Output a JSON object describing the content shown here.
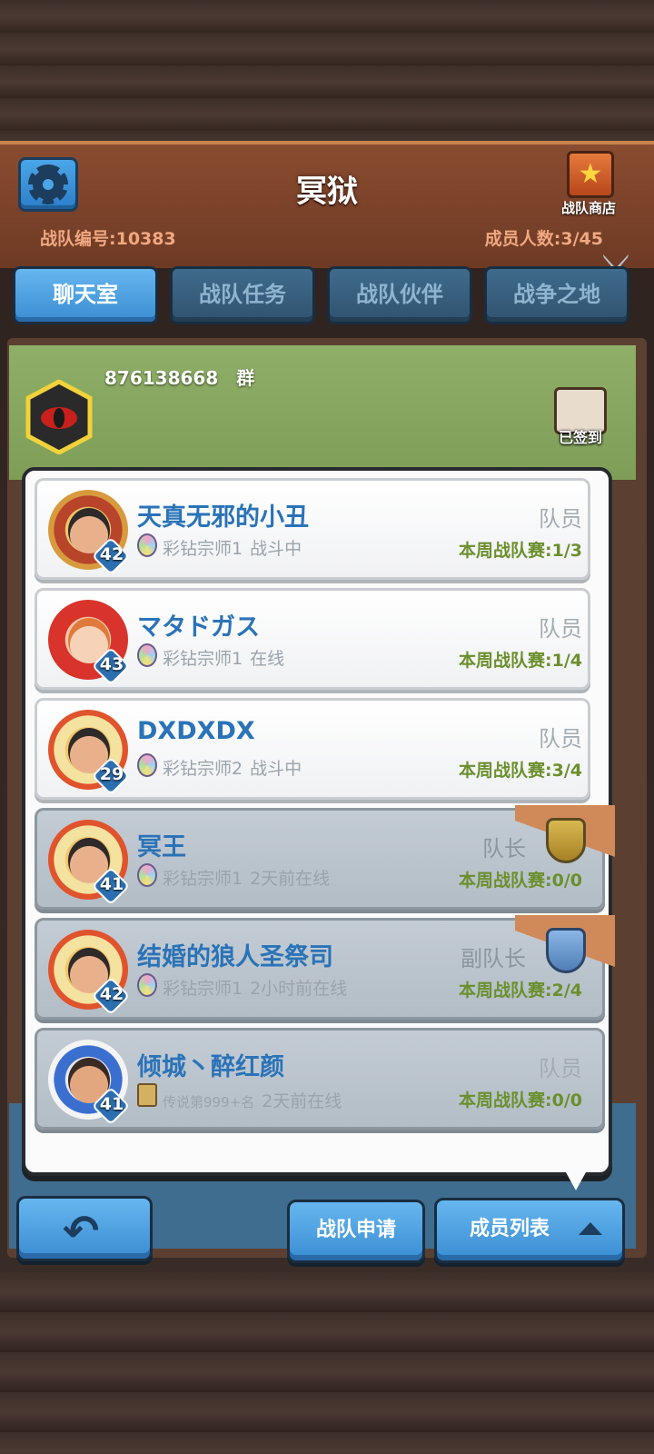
{
  "header": {
    "team_name": "冥狱",
    "team_id": "战队编号:10383",
    "member_count": "成员人数:3/45",
    "shop_label": "战队商店"
  },
  "tabs": [
    {
      "label": "聊天室",
      "active": true
    },
    {
      "label": "战队任务",
      "active": false
    },
    {
      "label": "战队伙伴",
      "active": false
    },
    {
      "label": "战争之地",
      "active": false
    }
  ],
  "chat": {
    "group_number": "876138668　群",
    "checkin_label": "已签到"
  },
  "members": [
    {
      "name": "天真无邪的小丑",
      "level": "42",
      "rank": "彩钻宗师1",
      "status": "战斗中",
      "role": "队员",
      "weekly": "本周战队赛:1/3",
      "online": true
    },
    {
      "name": "マタドガス",
      "level": "43",
      "rank": "彩钻宗师1",
      "status": "在线",
      "role": "队员",
      "weekly": "本周战队赛:1/4",
      "online": true
    },
    {
      "name": "DXDXDX",
      "level": "29",
      "rank": "彩钻宗师2",
      "status": "战斗中",
      "role": "队员",
      "weekly": "本周战队赛:3/4",
      "online": true
    },
    {
      "name": "冥王",
      "level": "41",
      "rank": "彩钻宗师1",
      "status": "2天前在线",
      "role": "队长",
      "weekly": "本周战队赛:0/0",
      "online": false
    },
    {
      "name": "结婚的狼人圣祭司",
      "level": "42",
      "rank": "彩钻宗师1",
      "status": "2小时前在线",
      "role": "副队长",
      "weekly": "本周战队赛:2/4",
      "online": false
    },
    {
      "name": "倾城丶醉红颜",
      "level": "41",
      "rank": "传说第999+名",
      "status": "2天前在线",
      "role": "队员",
      "weekly": "本周战队赛:0/0",
      "online": false
    }
  ],
  "bottom": {
    "apply_label": "战队申请",
    "list_label": "成员列表"
  },
  "colors": {
    "accent_blue": "#3a8dd2",
    "weekly_green": "#6b8f2c",
    "name_blue": "#2a73b8"
  }
}
